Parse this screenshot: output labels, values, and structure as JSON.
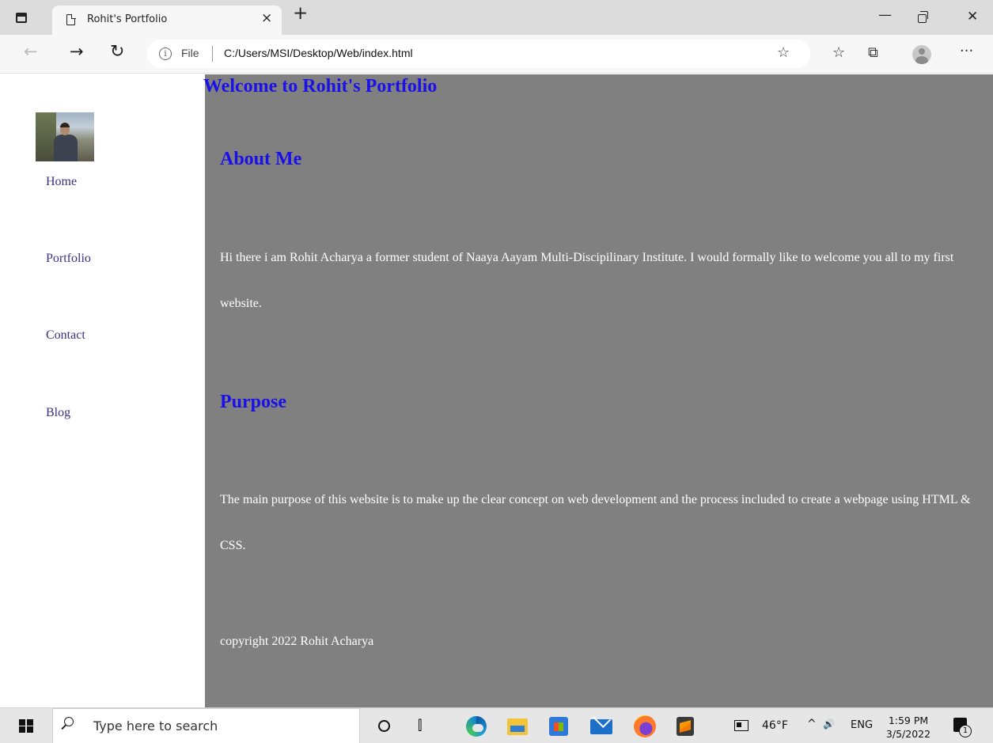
{
  "browser": {
    "tab": {
      "title": "Rohit's Portfolio",
      "close_glyph": "×"
    },
    "new_tab_glyph": "+",
    "window_controls": {
      "minimize": "—",
      "close": "✕"
    },
    "nav": {
      "back": "←",
      "forward": "→",
      "refresh": "↻"
    },
    "address": {
      "info_glyph": "i",
      "scheme_label": "File",
      "url": "C:/Users/MSI/Desktop/Web/index.html",
      "favorite_glyph": "☆"
    },
    "toolbar": {
      "favorites_glyph": "☆",
      "collections_glyph": "⧉",
      "more_glyph": "···"
    }
  },
  "page": {
    "sidebar": {
      "avatar_alt": "Rohit profile photo",
      "nav_items": [
        {
          "label": "Home"
        },
        {
          "label": "Portfolio"
        },
        {
          "label": "Contact"
        },
        {
          "label": "Blog"
        }
      ]
    },
    "main": {
      "title": "Welcome to Rohit's Portfolio",
      "sections": [
        {
          "heading": "About Me",
          "text": "Hi there i am Rohit Acharya a former student of Naaya Aayam Multi-Discipilinary Institute. I would formally like to welcome you all to my first website."
        },
        {
          "heading": "Purpose",
          "text": "The main purpose of this website is to make up the clear concept on web development and the process included to create a webpage using HTML & CSS."
        }
      ],
      "copyright": "copyright 2022 Rohit Acharya"
    },
    "colors": {
      "heading": "#1a10e8",
      "content_bg": "#808080",
      "link": "#3b2f7f"
    }
  },
  "taskbar": {
    "search_placeholder": "Type here to search",
    "weather": "46°F",
    "tray_chevron": "^",
    "volume_glyph": "🔊",
    "language": "ENG",
    "time": "1:59 PM",
    "date": "3/5/2022",
    "notification_count": "1"
  }
}
